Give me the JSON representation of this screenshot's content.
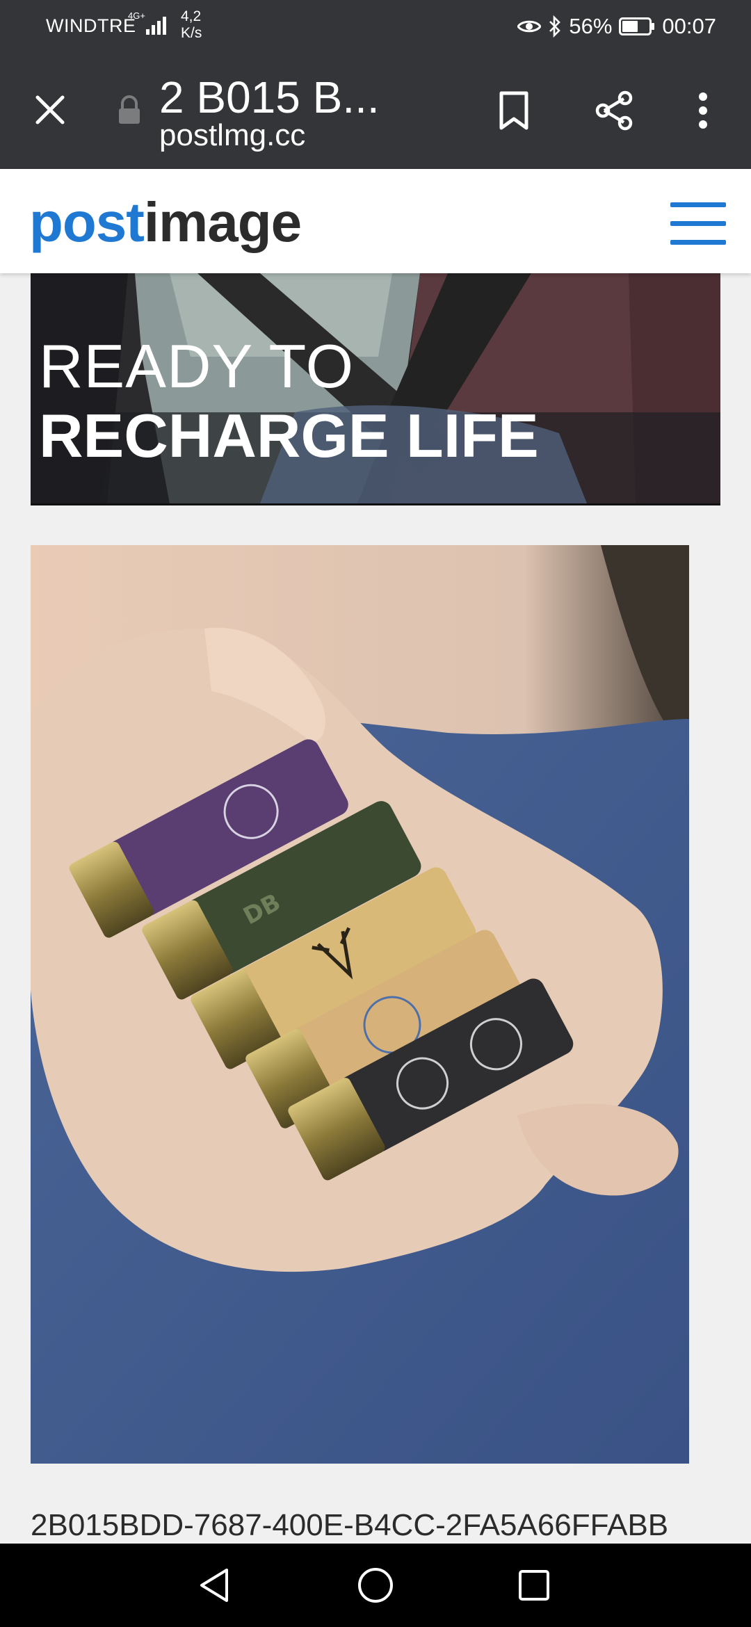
{
  "status_bar": {
    "carrier": "WINDTRE",
    "network": "4G+",
    "speed_value": "4,2",
    "speed_unit": "K/s",
    "battery": "56%",
    "time": "00:07"
  },
  "toolbar": {
    "title": "2 B015 B...",
    "host": "postlmg.cc"
  },
  "site": {
    "logo_part1": "post",
    "logo_part2": "image"
  },
  "ad": {
    "line1": "READY TO",
    "line2": "RECHARGE LIFE"
  },
  "image": {
    "filename": "2B015BDD-7687-400E-B4CC-2FA5A66FFABB"
  },
  "colors": {
    "chrome": "#343538",
    "brand_blue": "#1f78d1",
    "page_bg": "#f0f0f0"
  },
  "icons": [
    "close-icon",
    "lock-icon",
    "bookmark-icon",
    "share-icon",
    "more-vert-icon",
    "menu-icon",
    "back-icon",
    "home-icon",
    "recents-icon",
    "eye-icon",
    "bluetooth-icon",
    "battery-icon",
    "signal-icon"
  ]
}
